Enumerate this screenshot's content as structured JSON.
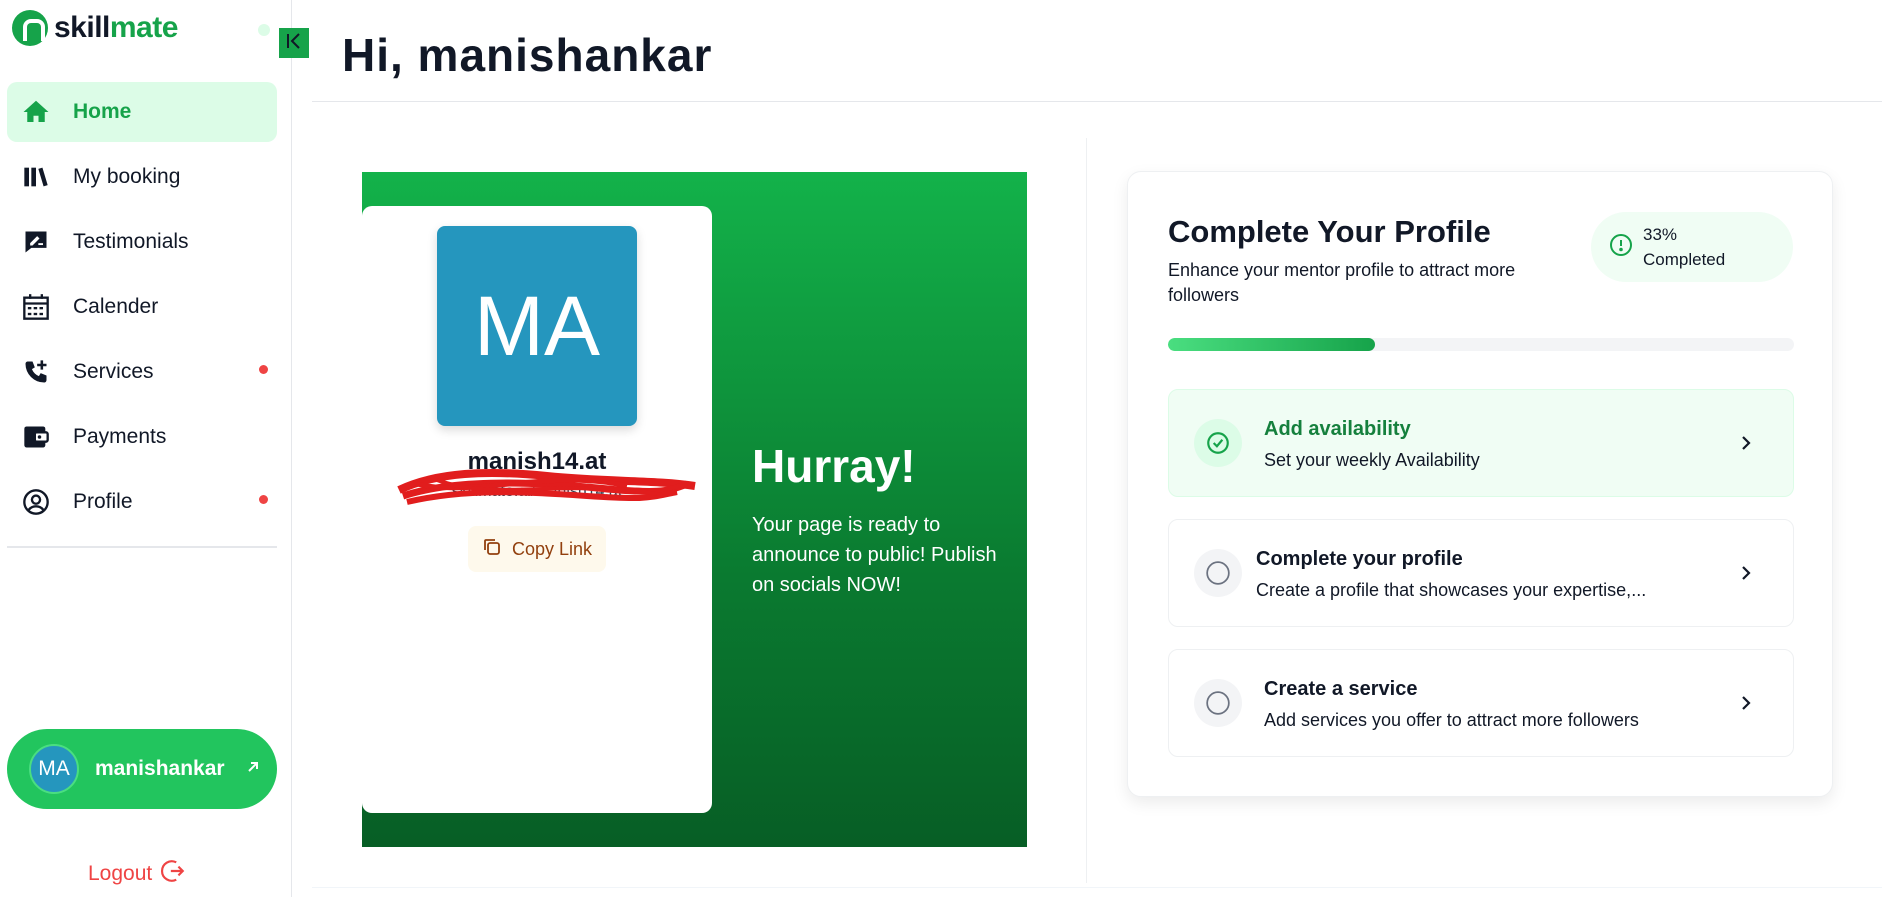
{
  "brand": {
    "name_part1": "skill",
    "name_part2": "mate"
  },
  "sidebar": {
    "items": [
      {
        "label": "Home",
        "active": true,
        "notification": false
      },
      {
        "label": "My booking",
        "active": false,
        "notification": false
      },
      {
        "label": "Testimonials",
        "active": false,
        "notification": false
      },
      {
        "label": "Calender",
        "active": false,
        "notification": false
      },
      {
        "label": "Services",
        "active": false,
        "notification": true
      },
      {
        "label": "Payments",
        "active": false,
        "notification": false
      },
      {
        "label": "Profile",
        "active": false,
        "notification": true
      }
    ],
    "user": {
      "initials": "MA",
      "name": "manishankar"
    },
    "logout_label": "Logout"
  },
  "header": {
    "greeting": "Hi, manishankar"
  },
  "share_card": {
    "avatar_initials": "MA",
    "username": "manish14.at",
    "link_text": "skillmate.ai/manish14.at",
    "copy_label": "Copy Link",
    "headline": "Hurray!",
    "message": "Your page is ready to announce to public! Publish on socials NOW!"
  },
  "profile_completion": {
    "title": "Complete Your Profile",
    "subtitle": "Enhance your mentor profile to attract more followers",
    "badge_text": "33% Completed",
    "progress_fraction": 0.33,
    "tasks": [
      {
        "title": "Add availability",
        "subtitle": "Set your weekly Availability",
        "done": true
      },
      {
        "title": "Complete your profile",
        "subtitle": "Create a profile that showcases your expertise,...",
        "done": false
      },
      {
        "title": "Create a service",
        "subtitle": "Add services you offer to attract more followers",
        "done": false
      }
    ]
  },
  "colors": {
    "brand_green": "#16a34a",
    "accent_light": "#dcfce7",
    "alert_red": "#ef4444",
    "avatar_blue": "#2596be"
  }
}
